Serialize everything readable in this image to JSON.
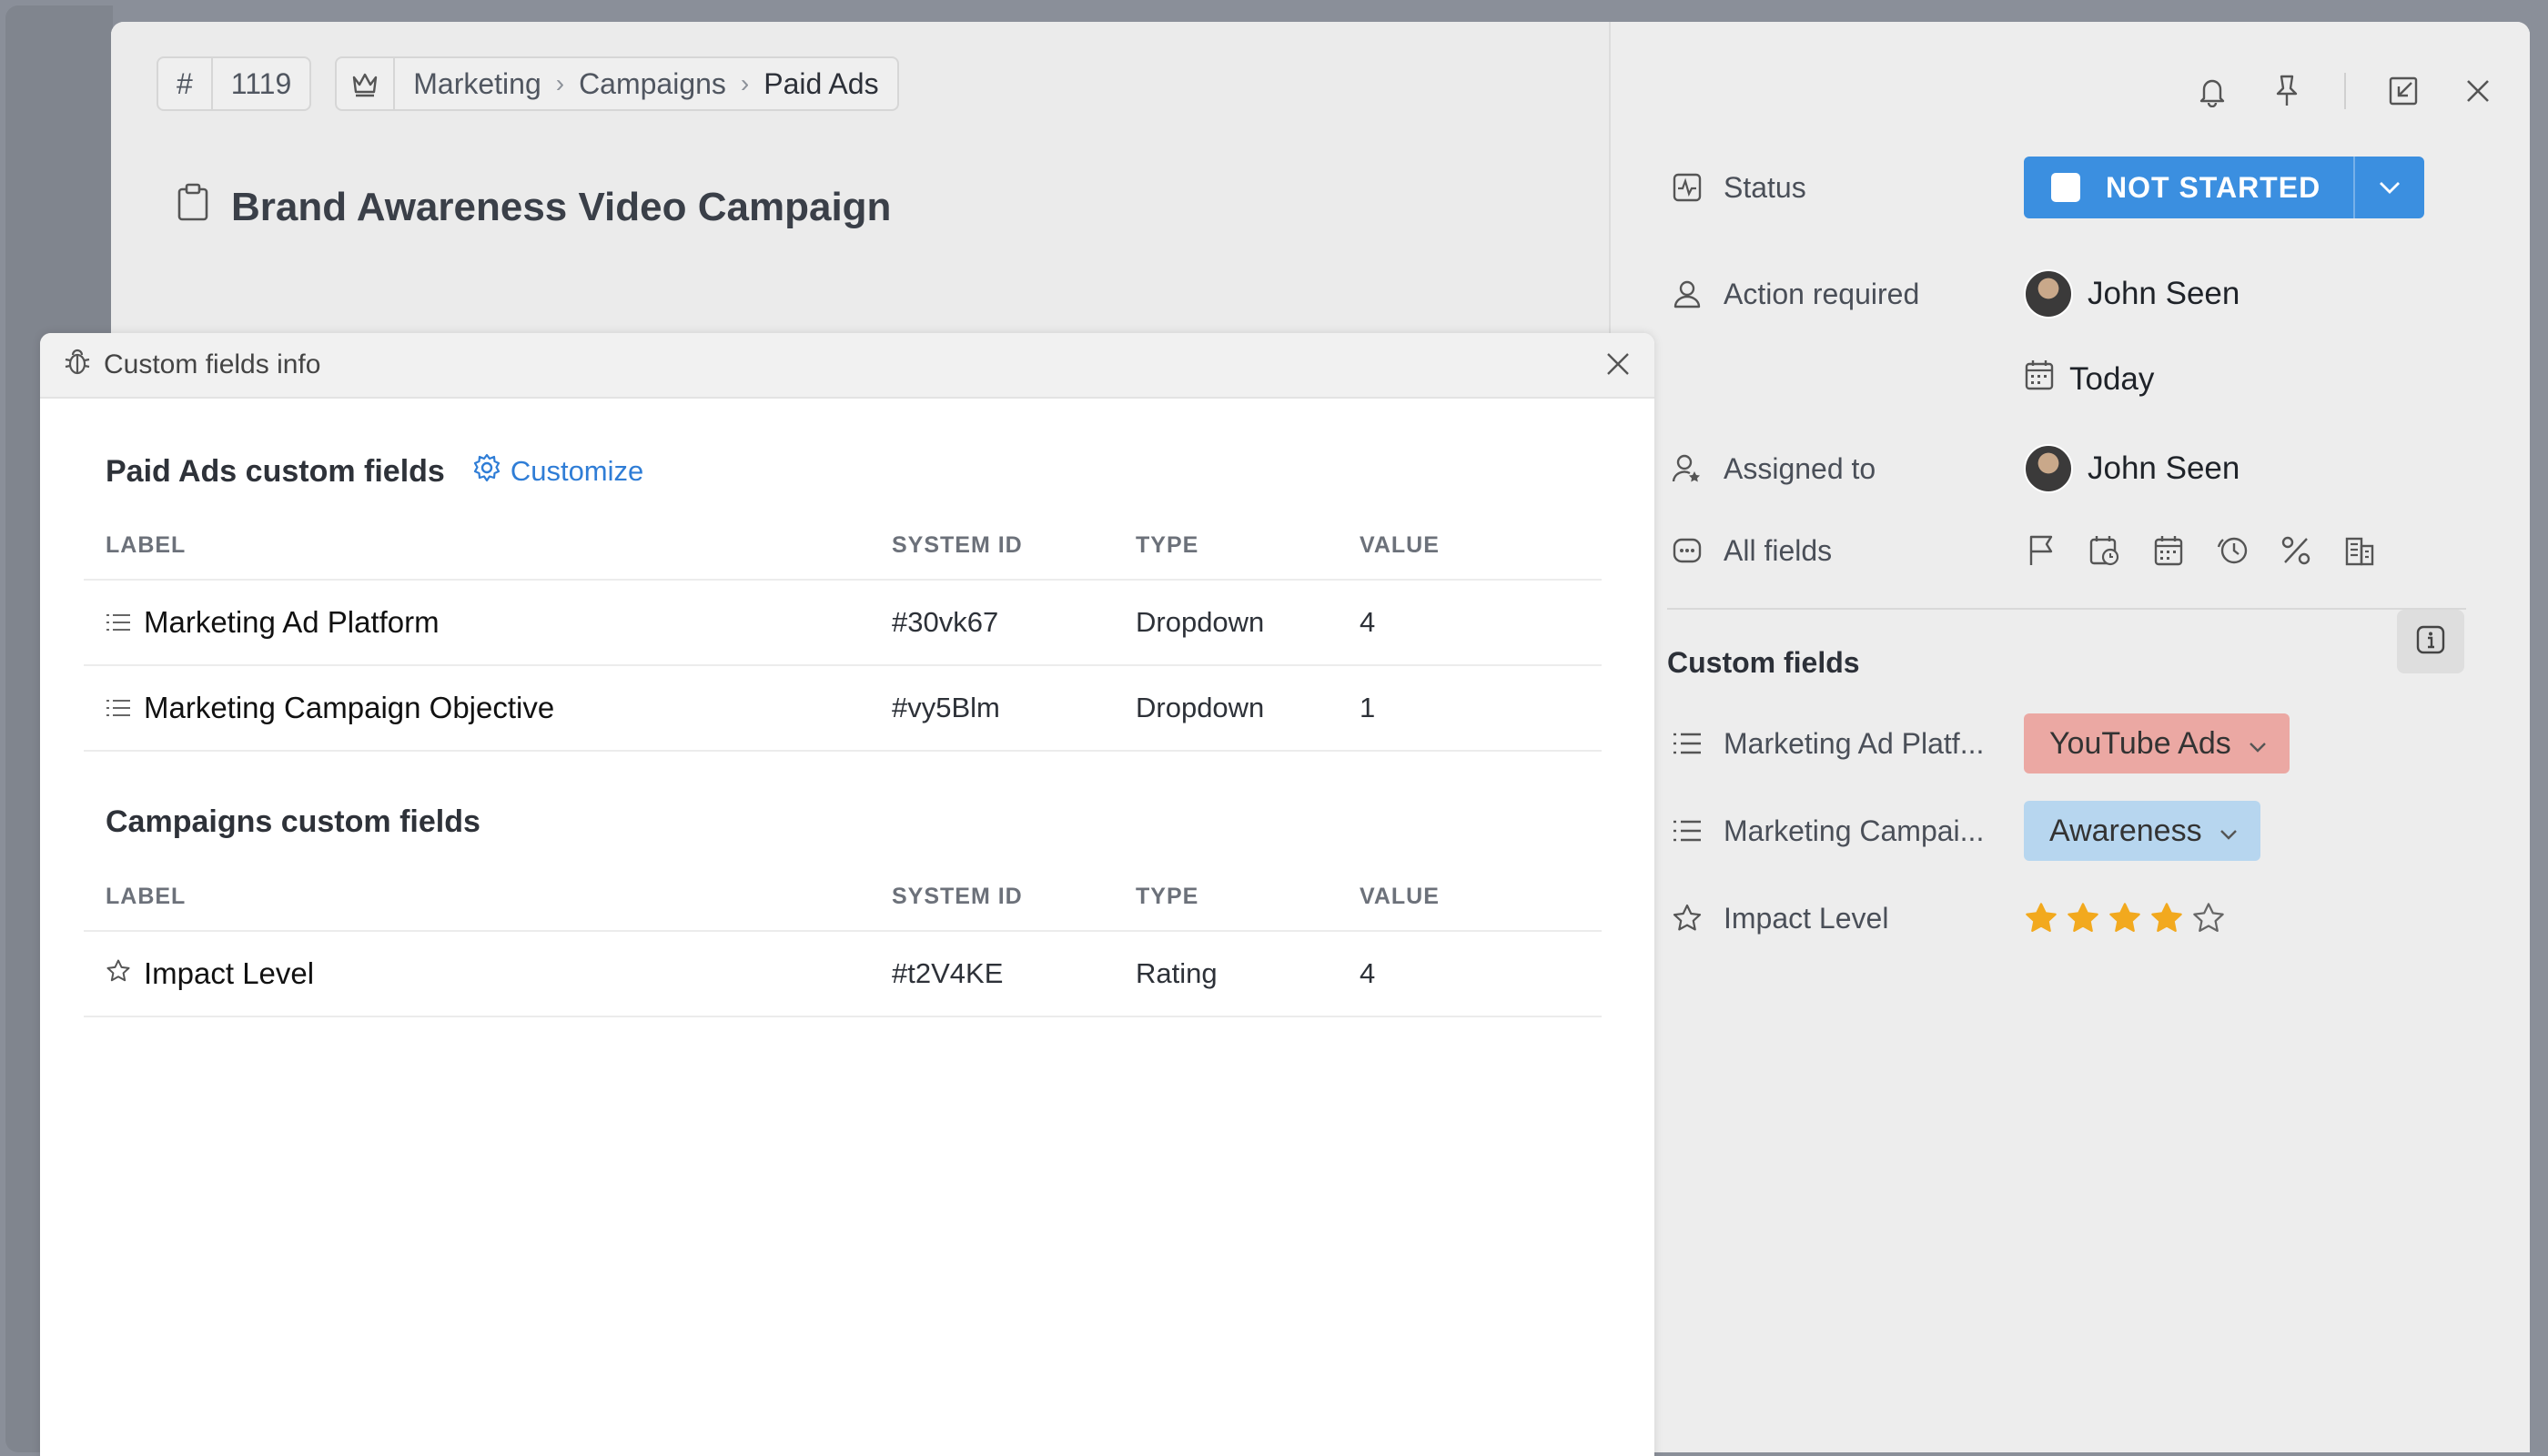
{
  "breadcrumb": {
    "hash": "#",
    "id": "1119",
    "path": [
      "Marketing",
      "Campaigns",
      "Paid Ads"
    ]
  },
  "task": {
    "title": "Brand Awareness Video Campaign"
  },
  "properties": {
    "status_label": "Status",
    "status_value": "NOT STARTED",
    "action_label": "Action required",
    "action_person": "John Seen",
    "action_date": "Today",
    "assigned_label": "Assigned to",
    "assigned_person": "John Seen",
    "all_fields_label": "All fields"
  },
  "custom_fields": {
    "title": "Custom fields",
    "items": [
      {
        "label": "Marketing Ad Platf...",
        "value": "YouTube Ads"
      },
      {
        "label": "Marketing Campai...",
        "value": "Awareness"
      },
      {
        "label": "Impact Level",
        "rating": 4,
        "max": 5
      }
    ]
  },
  "colors": {
    "status": "#3b8fe0",
    "pill_red": "#eba8a3",
    "pill_blue": "#b7d6ef",
    "star": "#f2a91e",
    "link": "#2f7dd6"
  },
  "overlay": {
    "title": "Custom fields info",
    "columns": {
      "label": "LABEL",
      "system_id": "SYSTEM ID",
      "type": "TYPE",
      "value": "VALUE"
    },
    "sections": [
      {
        "heading": "Paid Ads custom fields",
        "customize": "Customize",
        "rows": [
          {
            "label": "Marketing Ad Platform",
            "system_id": "#30vk67",
            "type": "Dropdown",
            "value": "4"
          },
          {
            "label": "Marketing Campaign Objective",
            "system_id": "#vy5Blm",
            "type": "Dropdown",
            "value": "1"
          }
        ]
      },
      {
        "heading": "Campaigns custom fields",
        "rows": [
          {
            "label": "Impact Level",
            "system_id": "#t2V4KE",
            "type": "Rating",
            "value": "4"
          }
        ]
      }
    ]
  }
}
